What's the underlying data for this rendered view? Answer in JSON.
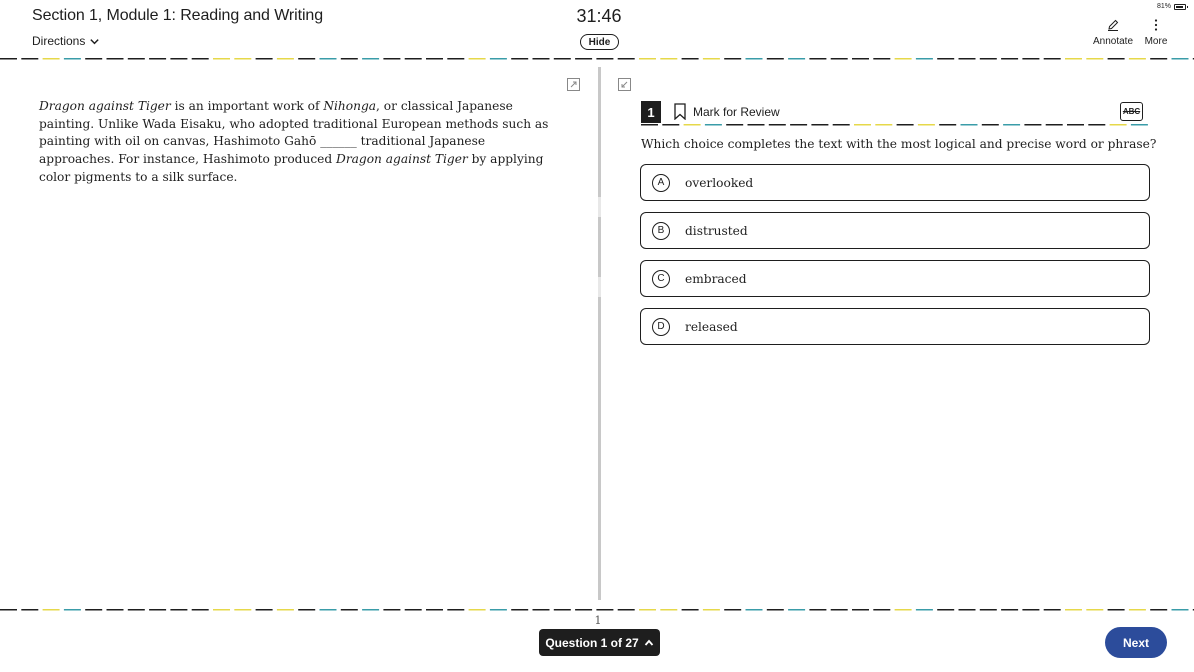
{
  "header": {
    "section_title": "Section 1, Module 1: Reading and Writing",
    "directions_label": "Directions",
    "timer": "31:46",
    "hide_label": "Hide",
    "annotate_label": "Annotate",
    "more_label": "More",
    "battery_percent": "81%"
  },
  "passage": {
    "title_work": "Dragon against Tiger",
    "seg1": " is an important work of ",
    "nihonga": "Nihonga",
    "seg2": ", or classical Japanese painting. Unlike Wada Eisaku, who adopted traditional European methods such as painting with oil on canvas, Hashimoto Gahō ______ traditional Japanese approaches. For instance, Hashimoto produced ",
    "title_work_2": "Dragon against Tiger",
    "seg3": " by applying color pigments to a silk surface."
  },
  "question": {
    "number": "1",
    "mark_for_review_label": "Mark for Review",
    "abc_label": "ABC",
    "prompt": "Which choice completes the text with the most logical and precise word or phrase?",
    "choices": [
      {
        "letter": "A",
        "text": "overlooked"
      },
      {
        "letter": "B",
        "text": "distrusted"
      },
      {
        "letter": "C",
        "text": "embraced"
      },
      {
        "letter": "D",
        "text": "released"
      }
    ]
  },
  "footer": {
    "page_number": "1",
    "question_nav_label": "Question 1 of 27",
    "next_label": "Next"
  },
  "colors": {
    "text": "#1e1e1e",
    "next_button": "#2c4c9b",
    "dash_yellow": "#e6d84a",
    "dash_teal": "#3a9ca8",
    "dash_dark": "#1e1e1e"
  },
  "icons": {
    "directions_chevron": "chevron-down-icon",
    "annotate": "pencil-icon",
    "more": "kebab-icon",
    "bookmark": "bookmark-icon",
    "expand": "expand-icon",
    "nav_chevron": "chevron-up-icon"
  }
}
